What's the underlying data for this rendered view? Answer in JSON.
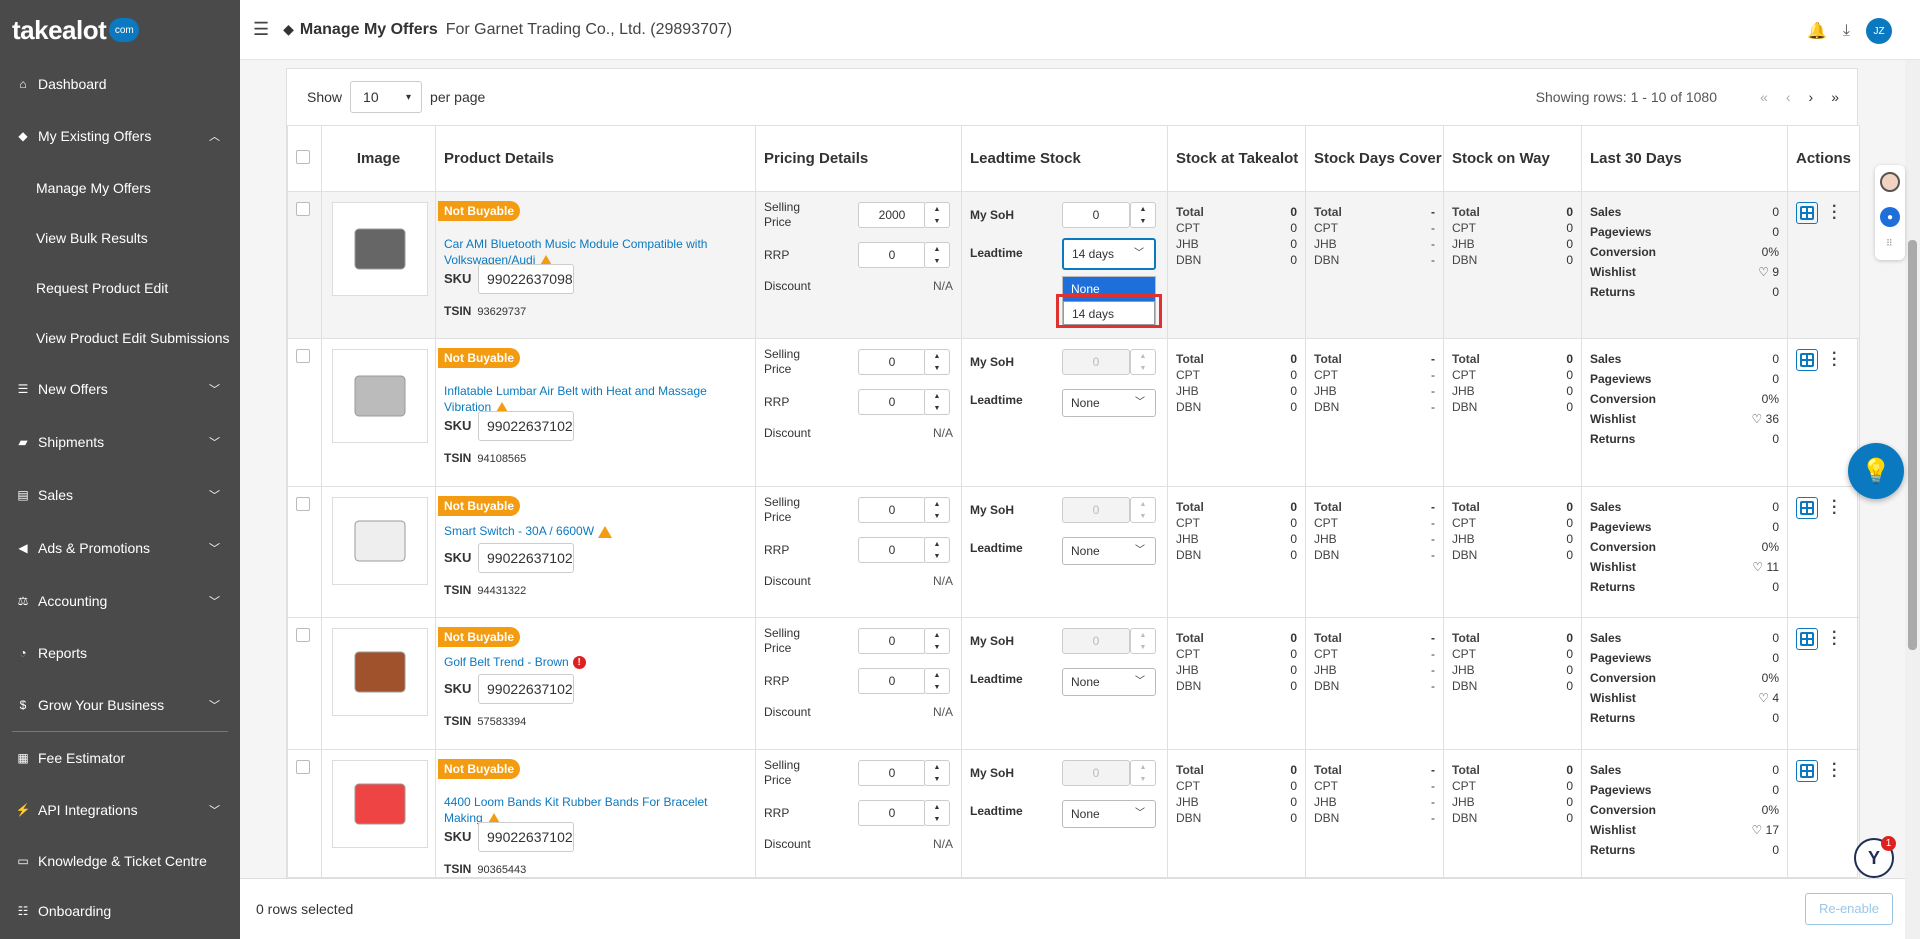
{
  "app": {
    "logo_text": "takealot",
    "logo_badge": "com"
  },
  "sidebar": {
    "dashboard": "Dashboard",
    "existing_offers": "My Existing Offers",
    "sub_manage": "Manage My Offers",
    "sub_bulk": "View Bulk Results",
    "sub_request": "Request Product Edit",
    "sub_view_edit": "View Product Edit Submissions",
    "new_offers": "New Offers",
    "shipments": "Shipments",
    "sales": "Sales",
    "ads": "Ads & Promotions",
    "accounting": "Accounting",
    "reports": "Reports",
    "grow": "Grow Your Business",
    "fee": "Fee Estimator",
    "api": "API Integrations",
    "knowledge": "Knowledge & Ticket Centre",
    "onboarding": "Onboarding"
  },
  "header": {
    "title": "Manage My Offers",
    "subtitle": "For Garnet Trading Co., Ltd. (29893707)",
    "avatar": "JZ"
  },
  "controls": {
    "show": "Show",
    "per_page_value": "10",
    "per_page": "per page",
    "showing": "Showing rows: 1 - 10 of 1080"
  },
  "columns": {
    "image": "Image",
    "product": "Product Details",
    "pricing": "Pricing Details",
    "leadtime": "Leadtime Stock",
    "stock_takealot": "Stock at Takealot",
    "stock_days": "Stock Days Cover",
    "stock_way": "Stock on Way",
    "last30": "Last 30 Days",
    "actions": "Actions"
  },
  "labels": {
    "not_buyable": "Not Buyable",
    "sku": "SKU",
    "tsin": "TSIN",
    "selling_price": "Selling Price",
    "rrp": "RRP",
    "discount": "Discount",
    "na": "N/A",
    "my_soh": "My SoH",
    "leadtime": "Leadtime",
    "total": "Total",
    "cpt": "CPT",
    "jhb": "JHB",
    "dbn": "DBN",
    "sales": "Sales",
    "pageviews": "Pageviews",
    "conversion": "Conversion",
    "wishlist": "Wishlist",
    "returns": "Returns",
    "dash": "-",
    "zero": "0",
    "zero_pct": "0%"
  },
  "dropdown": {
    "none": "None",
    "fourteen": "14 days"
  },
  "rows": [
    {
      "title": "Car AMI Bluetooth Music Module Compatible with Volkswagen/Audi",
      "sku": "99022637098",
      "tsin": "93629737",
      "selling": "2000",
      "rrp": "0",
      "soh": "0",
      "leadtime": "14 days",
      "wishlist": "9"
    },
    {
      "title": "Inflatable Lumbar Air Belt with Heat and Massage Vibration",
      "sku": "99022637102",
      "tsin": "94108565",
      "selling": "0",
      "rrp": "0",
      "soh": "0",
      "leadtime": "None",
      "wishlist": "36"
    },
    {
      "title": "Smart Switch - 30A / 6600W",
      "sku": "99022637102",
      "tsin": "94431322",
      "selling": "0",
      "rrp": "0",
      "soh": "0",
      "leadtime": "None",
      "wishlist": "11"
    },
    {
      "title": "Golf Belt Trend - Brown",
      "sku": "99022637102",
      "tsin": "57583394",
      "selling": "0",
      "rrp": "0",
      "soh": "0",
      "leadtime": "None",
      "wishlist": "4"
    },
    {
      "title": "4400 Loom Bands Kit Rubber Bands For Bracelet Making",
      "sku": "99022637102",
      "tsin": "90365443",
      "selling": "0",
      "rrp": "0",
      "soh": "0",
      "leadtime": "None",
      "wishlist": "17"
    }
  ],
  "footer": {
    "rows_selected": "0 rows selected",
    "reenable": "Re-enable"
  },
  "colors": {
    "sidebar": "#4a4a4a",
    "accent": "#0b79bf",
    "badge": "#f39c12",
    "highlight": "#e03030"
  }
}
